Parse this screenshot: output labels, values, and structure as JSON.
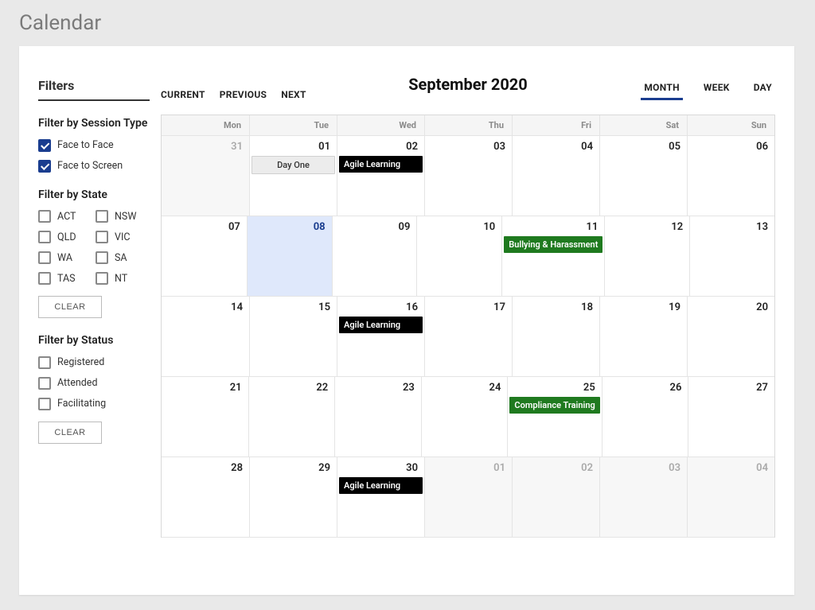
{
  "page": {
    "title": "Calendar"
  },
  "filters": {
    "heading": "Filters",
    "session_type_title": "Filter by Session Type",
    "session_types": [
      {
        "label": "Face to Face",
        "checked": true
      },
      {
        "label": "Face to Screen",
        "checked": true
      }
    ],
    "state_title": "Filter by State",
    "states": [
      {
        "label": "ACT",
        "checked": false
      },
      {
        "label": "NSW",
        "checked": false
      },
      {
        "label": "QLD",
        "checked": false
      },
      {
        "label": "VIC",
        "checked": false
      },
      {
        "label": "WA",
        "checked": false
      },
      {
        "label": "SA",
        "checked": false
      },
      {
        "label": "TAS",
        "checked": false
      },
      {
        "label": "NT",
        "checked": false
      }
    ],
    "status_title": "Filter by Status",
    "statuses": [
      {
        "label": "Registered",
        "checked": false
      },
      {
        "label": "Attended",
        "checked": false
      },
      {
        "label": "Facilitating",
        "checked": false
      }
    ],
    "clear_label": "CLEAR"
  },
  "nav": {
    "current": "CURRENT",
    "previous": "PREVIOUS",
    "next": "NEXT"
  },
  "calendar": {
    "title": "September 2020",
    "view_month": "MONTH",
    "view_week": "WEEK",
    "view_day": "DAY",
    "active_view": "MONTH",
    "day_headers": [
      "Mon",
      "Tue",
      "Wed",
      "Thu",
      "Fri",
      "Sat",
      "Sun"
    ],
    "weeks": [
      [
        {
          "num": "31",
          "outside": true
        },
        {
          "num": "01",
          "events": [
            {
              "label": "Day One",
              "style": "grey"
            }
          ]
        },
        {
          "num": "02",
          "events": [
            {
              "label": "Agile Learning",
              "style": "black"
            }
          ]
        },
        {
          "num": "03"
        },
        {
          "num": "04"
        },
        {
          "num": "05"
        },
        {
          "num": "06"
        }
      ],
      [
        {
          "num": "07"
        },
        {
          "num": "08",
          "selected": true
        },
        {
          "num": "09"
        },
        {
          "num": "10"
        },
        {
          "num": "11",
          "events": [
            {
              "label": "Bullying & Harassment",
              "style": "green"
            }
          ]
        },
        {
          "num": "12"
        },
        {
          "num": "13"
        }
      ],
      [
        {
          "num": "14"
        },
        {
          "num": "15"
        },
        {
          "num": "16",
          "events": [
            {
              "label": "Agile Learning",
              "style": "black"
            }
          ]
        },
        {
          "num": "17"
        },
        {
          "num": "18"
        },
        {
          "num": "19"
        },
        {
          "num": "20"
        }
      ],
      [
        {
          "num": "21"
        },
        {
          "num": "22"
        },
        {
          "num": "23"
        },
        {
          "num": "24"
        },
        {
          "num": "25",
          "events": [
            {
              "label": "Compliance Training",
              "style": "green"
            }
          ]
        },
        {
          "num": "26"
        },
        {
          "num": "27"
        }
      ],
      [
        {
          "num": "28"
        },
        {
          "num": "29"
        },
        {
          "num": "30",
          "events": [
            {
              "label": "Agile Learning",
              "style": "black"
            }
          ]
        },
        {
          "num": "01",
          "outside": true
        },
        {
          "num": "02",
          "outside": true
        },
        {
          "num": "03",
          "outside": true
        },
        {
          "num": "04",
          "outside": true
        }
      ]
    ]
  }
}
